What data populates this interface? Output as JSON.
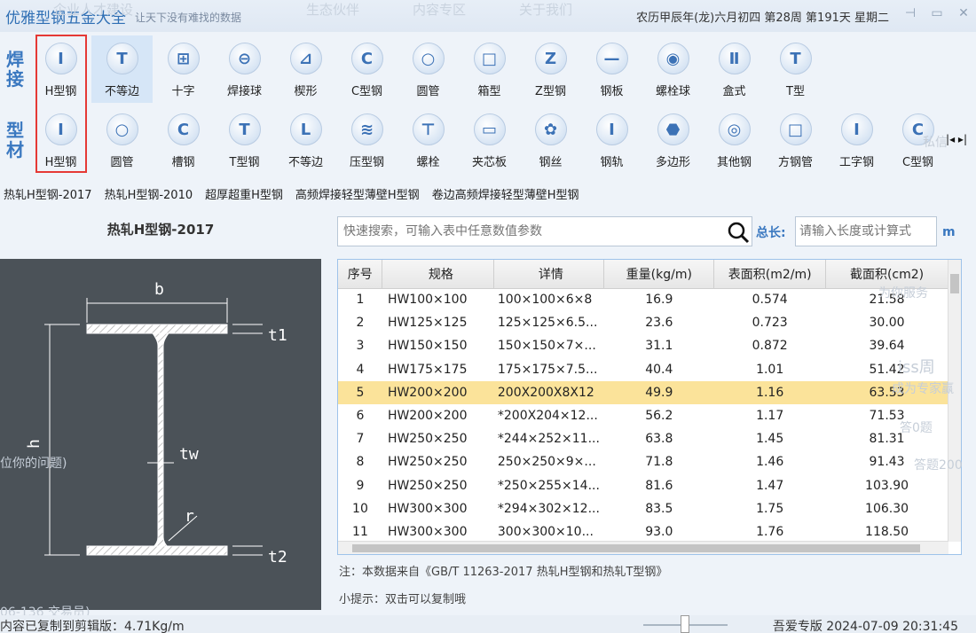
{
  "title_bar": {
    "app_title": "优雅型钢五金大全",
    "slogan": "让天下没有难找的数据",
    "ghost_nav": [
      "生态伙伴",
      "内容专区",
      "关于我们"
    ],
    "ghost_nav_left": "企业人才建设",
    "calendar": "农历甲辰年(龙)六月初四 第28周 第191天 星期二",
    "pin_icon": "pin-icon",
    "minimize_icon": "minimize-icon",
    "close_icon": "close-icon"
  },
  "weld_row": {
    "label_line1": "焊",
    "label_line2": "接",
    "items": [
      {
        "label": "H型钢",
        "glyph": "I"
      },
      {
        "label": "不等边",
        "glyph": "T"
      },
      {
        "label": "十字",
        "glyph": "⊞"
      },
      {
        "label": "焊接球",
        "glyph": "⊖"
      },
      {
        "label": "楔形",
        "glyph": "⊿"
      },
      {
        "label": "C型钢",
        "glyph": "C"
      },
      {
        "label": "圆管",
        "glyph": "○"
      },
      {
        "label": "箱型",
        "glyph": "□"
      },
      {
        "label": "Z型钢",
        "glyph": "Z"
      },
      {
        "label": "钢板",
        "glyph": "—"
      },
      {
        "label": "螺栓球",
        "glyph": "◉"
      },
      {
        "label": "盒式",
        "glyph": "Ⅱ"
      },
      {
        "label": "T型",
        "glyph": "T"
      }
    ]
  },
  "section_row": {
    "label_line1": "型",
    "label_line2": "材",
    "items": [
      {
        "label": "H型钢",
        "glyph": "I"
      },
      {
        "label": "圆管",
        "glyph": "○"
      },
      {
        "label": "槽钢",
        "glyph": "C"
      },
      {
        "label": "T型钢",
        "glyph": "T"
      },
      {
        "label": "不等边",
        "glyph": "L"
      },
      {
        "label": "压型钢",
        "glyph": "≋"
      },
      {
        "label": "螺栓",
        "glyph": "⊤"
      },
      {
        "label": "夹芯板",
        "glyph": "▭"
      },
      {
        "label": "钢丝",
        "glyph": "✿"
      },
      {
        "label": "钢轨",
        "glyph": "I"
      },
      {
        "label": "多边形",
        "glyph": "⬣"
      },
      {
        "label": "其他钢",
        "glyph": "◎"
      },
      {
        "label": "方钢管",
        "glyph": "□"
      },
      {
        "label": "工字钢",
        "glyph": "I"
      },
      {
        "label": "C型钢",
        "glyph": "C"
      }
    ],
    "arrows": "|◂ ▸|"
  },
  "subtabs": [
    "热轧H型钢-2017",
    "热轧H型钢-2010",
    "超厚超重H型钢",
    "高频焊接轻型薄壁H型钢",
    "卷边高频焊接轻型薄壁H型钢"
  ],
  "left_panel": {
    "title": "热轧H型钢-2017",
    "dims": {
      "b": "b",
      "t1": "t1",
      "h": "h",
      "tw": "tw",
      "r": "r",
      "t2": "t2"
    }
  },
  "search": {
    "placeholder": "快速搜索，可输入表中任意数值参数",
    "value": "",
    "total_length_label": "总长:",
    "length_placeholder": "请输入长度或计算式",
    "length_unit": "m"
  },
  "table": {
    "headers": [
      "序号",
      "规格",
      "详情",
      "重量(kg/m)",
      "表面积(m2/m)",
      "截面积(cm2)"
    ],
    "rows": [
      [
        "1",
        "HW100×100",
        "100×100×6×8",
        "16.9",
        "0.574",
        "21.58"
      ],
      [
        "2",
        "HW125×125",
        "125×125×6.5...",
        "23.6",
        "0.723",
        "30.00"
      ],
      [
        "3",
        "HW150×150",
        "150×150×7×...",
        "31.1",
        "0.872",
        "39.64"
      ],
      [
        "4",
        "HW175×175",
        "175×175×7.5...",
        "40.4",
        "1.01",
        "51.42"
      ],
      [
        "5",
        "HW200×200",
        "200X200X8X12",
        "49.9",
        "1.16",
        "63.53"
      ],
      [
        "6",
        "HW200×200",
        "*200X204×12...",
        "56.2",
        "1.17",
        "71.53"
      ],
      [
        "7",
        "HW250×250",
        "*244×252×11...",
        "63.8",
        "1.45",
        "81.31"
      ],
      [
        "8",
        "HW250×250",
        "250×250×9×...",
        "71.8",
        "1.46",
        "91.43"
      ],
      [
        "9",
        "HW250×250",
        "*250×255×14...",
        "81.6",
        "1.47",
        "103.90"
      ],
      [
        "10",
        "HW300×300",
        "*294×302×12...",
        "83.5",
        "1.75",
        "106.30"
      ],
      [
        "11",
        "HW300×300",
        "300×300×10...",
        "93.0",
        "1.76",
        "118.50"
      ]
    ],
    "highlighted_row": 5
  },
  "note": "注：本数据来自《GB/T  11263-2017 热轧H型钢和热轧T型钢》",
  "tip": "小提示：双击可以复制哦",
  "ghost_texts": {
    "left_q": "位你的问题)",
    "ghost_bottom_left": "06-136 交易员)",
    "right_1": "为你服务",
    "right_2": "iss周",
    "right_3": "成为专家赢",
    "right_4": "答0题",
    "right_5": "答题200",
    "right_6": "私信"
  },
  "status_bar": {
    "left": "内容已复制到剪辑版：4.71Kg/m",
    "right": "吾爱专版  2024-07-09 20:31:45"
  }
}
